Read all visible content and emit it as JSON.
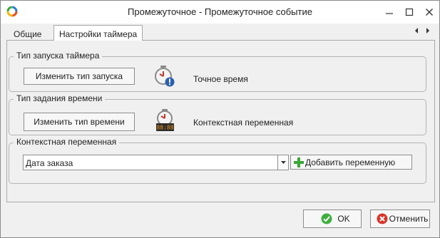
{
  "window": {
    "title": "Промежуточное - Промежуточное событие"
  },
  "tabs": [
    {
      "label": "Общие"
    },
    {
      "label": "Настройки таймера"
    }
  ],
  "groups": {
    "trigger": {
      "label": "Тип запуска таймера",
      "button_label": "Изменить тип запуска",
      "icon": "clock-alert-icon",
      "value": "Точное время"
    },
    "time": {
      "label": "Тип задания времени",
      "button_label": "Изменить тип времени",
      "icon": "clock-digital-icon",
      "clock_digits": "88:88",
      "value": "Контекстная переменная"
    },
    "context": {
      "label": "Контекстная переменная",
      "select_value": "Дата заказа",
      "add_button_label": "Добавить переменную"
    }
  },
  "footer": {
    "ok_label": "OK",
    "cancel_label": "Отменить"
  },
  "colors": {
    "ok_green": "#3fae3f",
    "cancel_red": "#d9362b",
    "plus_green": "#3aa83a",
    "alert_blue": "#2a5fb0",
    "clock_red": "#c0392b"
  }
}
